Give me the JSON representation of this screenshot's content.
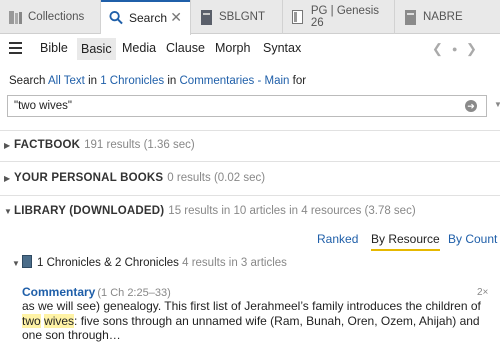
{
  "tabs": [
    {
      "label": "Collections",
      "icon": "collections-icon"
    },
    {
      "label": "Search",
      "icon": "search-icon"
    },
    {
      "label": "SBLGNT",
      "icon": "book-icon"
    },
    {
      "label": "PG | Genesis 26",
      "icon": "page-icon"
    },
    {
      "label": "NABRE",
      "icon": "book-icon"
    }
  ],
  "menu": {
    "items": [
      "Bible",
      "Basic",
      "Media",
      "Clause",
      "Morph",
      "Syntax"
    ],
    "active": "Basic"
  },
  "search": {
    "prefix": "Search",
    "scope": "All Text",
    "in1": "in",
    "range": "1 Chronicles",
    "in2": "in",
    "collection": "Commentaries - Main",
    "suffix": "for",
    "query": "\"two wives\""
  },
  "sections": [
    {
      "title": "FACTBOOK",
      "meta": "191 results (1.36 sec)"
    },
    {
      "title": "YOUR PERSONAL BOOKS",
      "meta": "0 results (0.02 sec)"
    },
    {
      "title": "LIBRARY (DOWNLOADED)",
      "meta": "15 results in 10 articles in 4 resources (3.78 sec)"
    }
  ],
  "sort": {
    "options": [
      "Ranked",
      "By Resource",
      "By Count"
    ],
    "active": "By Resource"
  },
  "resource": {
    "title": "1 Chronicles & 2 Chronicles",
    "meta": "4 results in 3 articles"
  },
  "hit": {
    "title": "Commentary",
    "ref": "(1 Ch 2:25–33)",
    "count": "2×",
    "text_before": "as we will see) genealogy. This first list of Jerahmeel’s family introduces the children of ",
    "hl1": "two",
    "text_mid": "",
    "hl2": "wives",
    "text_after": ": five sons through an unnamed wife (Ram, Bunah, Oren, Ozem, Ahijah) and one son through…"
  },
  "colors": {
    "link": "#1f5fa9",
    "highlight": "#fff3a6",
    "tabbar": "#e9e9e9",
    "accent_underline": "#e6b800"
  }
}
